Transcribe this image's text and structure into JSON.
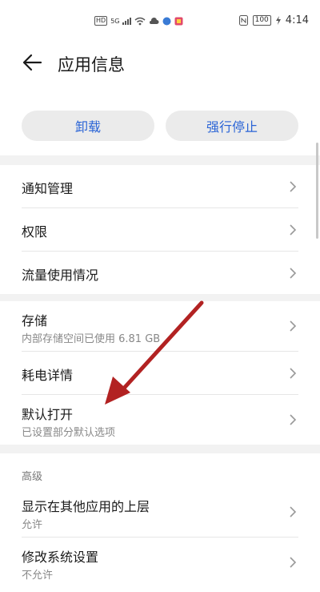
{
  "status_bar": {
    "hd_badge": "HD",
    "net_tag": "5G",
    "battery": "100",
    "time": "4:14"
  },
  "header": {
    "title": "应用信息"
  },
  "actions": {
    "uninstall": "卸载",
    "force_stop": "强行停止"
  },
  "group1": [
    {
      "label": "通知管理"
    },
    {
      "label": "权限"
    },
    {
      "label": "流量使用情况"
    }
  ],
  "group2": [
    {
      "label": "存储",
      "sub": "内部存储空间已使用 6.81 GB"
    },
    {
      "label": "耗电详情"
    },
    {
      "label": "默认打开",
      "sub": "已设置部分默认选项"
    }
  ],
  "advanced": {
    "title": "高级",
    "items": [
      {
        "label": "显示在其他应用的上层",
        "sub": "允许"
      },
      {
        "label": "修改系统设置",
        "sub": "不允许"
      }
    ]
  },
  "colors": {
    "accent": "#2a64d6",
    "annotation_arrow": "#b22222"
  }
}
